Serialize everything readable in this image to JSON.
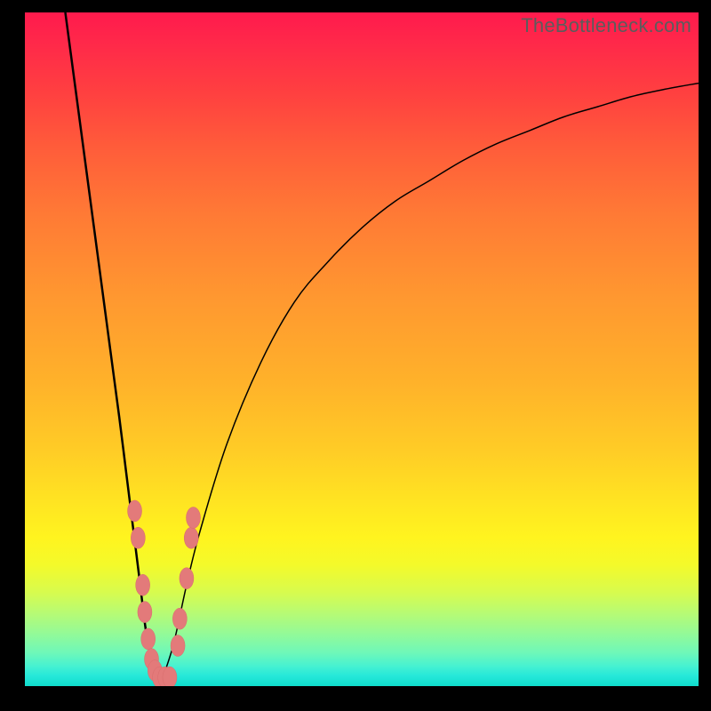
{
  "watermark": "TheBottleneck.com",
  "colors": {
    "frame_background": "#000000",
    "curve_stroke": "#000000",
    "marker_fill": "#e37a7a",
    "gradient_top": "#ff1a4d",
    "gradient_mid": "#ffe222",
    "gradient_bottom": "#10dccc",
    "watermark_text": "#5c5c5c"
  },
  "chart_data": {
    "type": "line",
    "title": "",
    "xlabel": "",
    "ylabel": "",
    "xlim": [
      0,
      100
    ],
    "ylim": [
      0,
      100
    ],
    "note": "Axes are unitless (no ticks in source). y is relative bottleneck magnitude (0 at bottom/green, 100 at top/red). Valley bottom near x≈20.",
    "series": [
      {
        "name": "left-branch",
        "x": [
          6,
          8,
          10,
          12,
          14,
          15,
          16,
          17,
          18,
          19,
          20
        ],
        "y": [
          100,
          85,
          70,
          55,
          40,
          32,
          24,
          16,
          8,
          3,
          0
        ]
      },
      {
        "name": "right-branch",
        "x": [
          20,
          22,
          24,
          26,
          30,
          35,
          40,
          45,
          50,
          55,
          60,
          65,
          70,
          75,
          80,
          85,
          90,
          95,
          100
        ],
        "y": [
          0,
          6,
          15,
          23,
          36,
          48,
          57,
          63,
          68,
          72,
          75,
          78,
          80.5,
          82.5,
          84.5,
          86,
          87.5,
          88.6,
          89.5
        ]
      }
    ],
    "highlight_markers": {
      "name": "data-markers",
      "points": [
        {
          "x": 16.3,
          "y": 26
        },
        {
          "x": 16.8,
          "y": 22
        },
        {
          "x": 17.5,
          "y": 15
        },
        {
          "x": 17.8,
          "y": 11
        },
        {
          "x": 18.3,
          "y": 7
        },
        {
          "x": 18.8,
          "y": 4
        },
        {
          "x": 19.3,
          "y": 2.3
        },
        {
          "x": 20.0,
          "y": 1.3
        },
        {
          "x": 20.8,
          "y": 1.3
        },
        {
          "x": 21.5,
          "y": 1.3
        },
        {
          "x": 22.7,
          "y": 6
        },
        {
          "x": 23.0,
          "y": 10
        },
        {
          "x": 24.0,
          "y": 16
        },
        {
          "x": 24.7,
          "y": 22
        },
        {
          "x": 25.0,
          "y": 25
        }
      ]
    }
  }
}
